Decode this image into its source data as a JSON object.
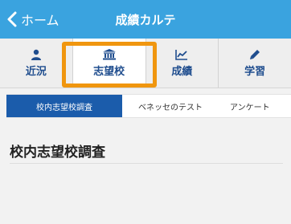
{
  "header": {
    "back_label": "ホーム",
    "title": "成績カルテ",
    "color": "#3aa3df"
  },
  "tabs": [
    {
      "label": "近況",
      "icon": "person-icon"
    },
    {
      "label": "志望校",
      "icon": "institution-icon",
      "active": true
    },
    {
      "label": "成績",
      "icon": "line-chart-icon"
    },
    {
      "label": "学習",
      "icon": "pencil-icon"
    }
  ],
  "subtabs": [
    {
      "label": "校内志望校調査",
      "active": true
    },
    {
      "label": "ベネッセのテスト"
    },
    {
      "label": "アンケート"
    }
  ],
  "content": {
    "title": "校内志望校調査"
  },
  "colors": {
    "highlight": "#f0960f",
    "tab_text": "#1f4d8e",
    "active_subtab": "#1b5cab"
  }
}
